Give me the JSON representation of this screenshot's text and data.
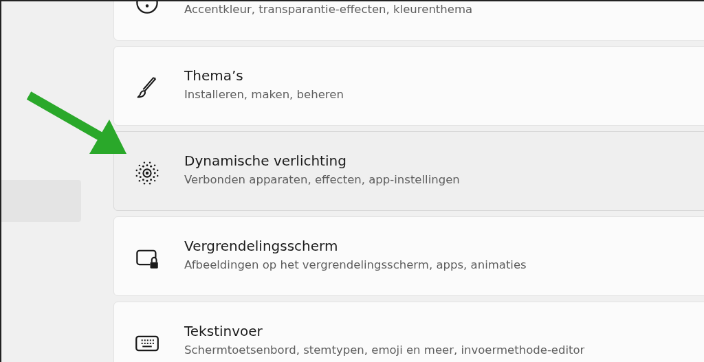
{
  "settings_list": [
    {
      "kind": "palette",
      "subtitle": "Accentkleur, transparantie-effecten, kleurenthema",
      "highlighted": false
    },
    {
      "kind": "brush",
      "title": "Thema’s",
      "subtitle": "Installeren, maken, beheren",
      "highlighted": false
    },
    {
      "kind": "lighting",
      "title": "Dynamische verlichting",
      "subtitle": "Verbonden apparaten, effecten, app-instellingen",
      "highlighted": true
    },
    {
      "kind": "lockscreen",
      "title": "Vergrendelingsscherm",
      "subtitle": "Afbeeldingen op het vergrendelingsscherm, apps, animaties",
      "highlighted": false
    },
    {
      "kind": "keyboard",
      "title": "Tekstinvoer",
      "subtitle": "Schermtoetsenbord, stemtypen, emoji en meer, invoermethode-editor",
      "highlighted": false
    }
  ]
}
